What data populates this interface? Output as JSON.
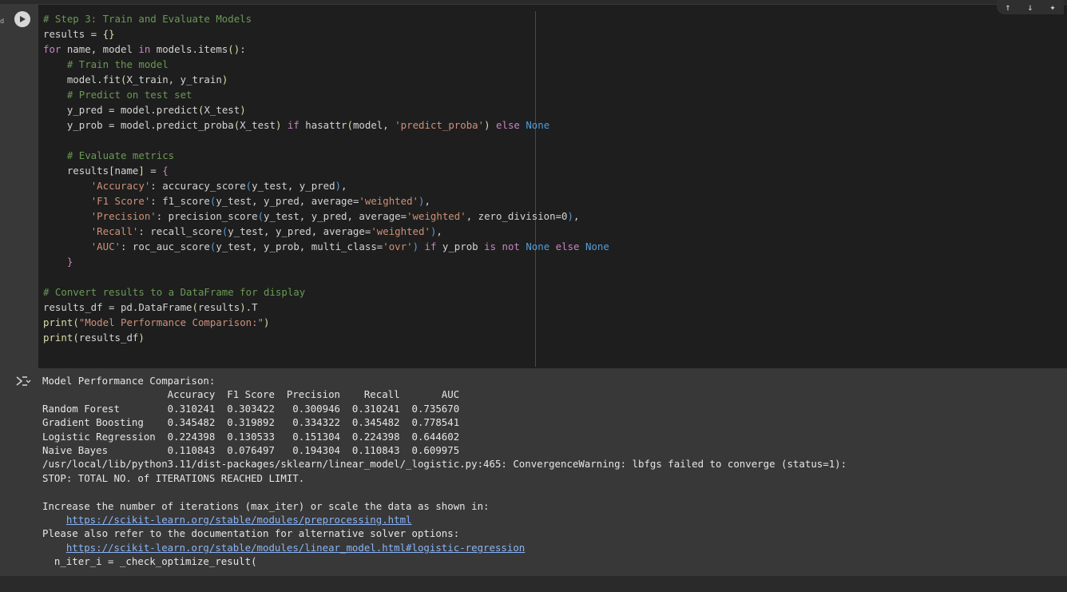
{
  "edge_label": "d",
  "cell": {
    "code_lines": [
      [
        {
          "t": "cm",
          "v": "# Step 3: Train and Evaluate Models"
        }
      ],
      [
        {
          "t": "",
          "v": "results = "
        },
        {
          "t": "fn",
          "v": "{}"
        }
      ],
      [
        {
          "t": "kw",
          "v": "for"
        },
        {
          "t": "",
          "v": " name, model "
        },
        {
          "t": "kw",
          "v": "in"
        },
        {
          "t": "",
          "v": " models.items"
        },
        {
          "t": "fn",
          "v": "()"
        },
        {
          "t": "",
          "v": ":"
        }
      ],
      [
        {
          "t": "",
          "v": "    "
        },
        {
          "t": "cm",
          "v": "# Train the model"
        }
      ],
      [
        {
          "t": "",
          "v": "    model.fit"
        },
        {
          "t": "fn",
          "v": "("
        },
        {
          "t": "",
          "v": "X_train, y_train"
        },
        {
          "t": "fn",
          "v": ")"
        }
      ],
      [
        {
          "t": "",
          "v": "    "
        },
        {
          "t": "cm",
          "v": "# Predict on test set"
        }
      ],
      [
        {
          "t": "",
          "v": "    y_pred = model.predict"
        },
        {
          "t": "fn",
          "v": "("
        },
        {
          "t": "",
          "v": "X_test"
        },
        {
          "t": "fn",
          "v": ")"
        }
      ],
      [
        {
          "t": "",
          "v": "    y_prob = model.predict_proba"
        },
        {
          "t": "fn",
          "v": "("
        },
        {
          "t": "",
          "v": "X_test"
        },
        {
          "t": "fn",
          "v": ")"
        },
        {
          "t": "",
          "v": " "
        },
        {
          "t": "kw",
          "v": "if"
        },
        {
          "t": "",
          "v": " hasattr"
        },
        {
          "t": "fn",
          "v": "("
        },
        {
          "t": "",
          "v": "model, "
        },
        {
          "t": "str",
          "v": "'predict_proba'"
        },
        {
          "t": "fn",
          "v": ")"
        },
        {
          "t": "",
          "v": " "
        },
        {
          "t": "kw",
          "v": "else"
        },
        {
          "t": "",
          "v": " "
        },
        {
          "t": "con",
          "v": "None"
        }
      ],
      [
        {
          "t": "",
          "v": ""
        }
      ],
      [
        {
          "t": "",
          "v": "    "
        },
        {
          "t": "cm",
          "v": "# Evaluate metrics"
        }
      ],
      [
        {
          "t": "",
          "v": "    results"
        },
        {
          "t": "fn",
          "v": "["
        },
        {
          "t": "",
          "v": "name"
        },
        {
          "t": "fn",
          "v": "]"
        },
        {
          "t": "",
          "v": " = "
        },
        {
          "t": "kw",
          "v": "{"
        }
      ],
      [
        {
          "t": "",
          "v": "        "
        },
        {
          "t": "str",
          "v": "'Accuracy'"
        },
        {
          "t": "",
          "v": ": accuracy_score"
        },
        {
          "t": "con",
          "v": "("
        },
        {
          "t": "",
          "v": "y_test, y_pred"
        },
        {
          "t": "con",
          "v": ")"
        },
        {
          "t": "",
          "v": ","
        }
      ],
      [
        {
          "t": "",
          "v": "        "
        },
        {
          "t": "str",
          "v": "'F1 Score'"
        },
        {
          "t": "",
          "v": ": f1_score"
        },
        {
          "t": "con",
          "v": "("
        },
        {
          "t": "",
          "v": "y_test, y_pred, average="
        },
        {
          "t": "str",
          "v": "'weighted'"
        },
        {
          "t": "con",
          "v": ")"
        },
        {
          "t": "",
          "v": ","
        }
      ],
      [
        {
          "t": "",
          "v": "        "
        },
        {
          "t": "str",
          "v": "'Precision'"
        },
        {
          "t": "",
          "v": ": precision_score"
        },
        {
          "t": "con",
          "v": "("
        },
        {
          "t": "",
          "v": "y_test, y_pred, average="
        },
        {
          "t": "str",
          "v": "'weighted'"
        },
        {
          "t": "",
          "v": ", zero_division=0"
        },
        {
          "t": "con",
          "v": ")"
        },
        {
          "t": "",
          "v": ","
        }
      ],
      [
        {
          "t": "",
          "v": "        "
        },
        {
          "t": "str",
          "v": "'Recall'"
        },
        {
          "t": "",
          "v": ": recall_score"
        },
        {
          "t": "con",
          "v": "("
        },
        {
          "t": "",
          "v": "y_test, y_pred, average="
        },
        {
          "t": "str",
          "v": "'weighted'"
        },
        {
          "t": "con",
          "v": ")"
        },
        {
          "t": "",
          "v": ","
        }
      ],
      [
        {
          "t": "",
          "v": "        "
        },
        {
          "t": "str",
          "v": "'AUC'"
        },
        {
          "t": "",
          "v": ": roc_auc_score"
        },
        {
          "t": "con",
          "v": "("
        },
        {
          "t": "",
          "v": "y_test, y_prob, multi_class="
        },
        {
          "t": "str",
          "v": "'ovr'"
        },
        {
          "t": "con",
          "v": ")"
        },
        {
          "t": "",
          "v": " "
        },
        {
          "t": "kw",
          "v": "if"
        },
        {
          "t": "",
          "v": " y_prob "
        },
        {
          "t": "kw",
          "v": "is"
        },
        {
          "t": "",
          "v": " "
        },
        {
          "t": "kw",
          "v": "not"
        },
        {
          "t": "",
          "v": " "
        },
        {
          "t": "con",
          "v": "None"
        },
        {
          "t": "",
          "v": " "
        },
        {
          "t": "kw",
          "v": "else"
        },
        {
          "t": "",
          "v": " "
        },
        {
          "t": "con",
          "v": "None"
        }
      ],
      [
        {
          "t": "",
          "v": "    "
        },
        {
          "t": "kw",
          "v": "}"
        }
      ],
      [
        {
          "t": "",
          "v": ""
        }
      ],
      [
        {
          "t": "cm",
          "v": "# Convert results to a DataFrame for display"
        }
      ],
      [
        {
          "t": "",
          "v": "results_df = pd.DataFrame"
        },
        {
          "t": "fn",
          "v": "("
        },
        {
          "t": "",
          "v": "results"
        },
        {
          "t": "fn",
          "v": ")"
        },
        {
          "t": "",
          "v": ".T"
        }
      ],
      [
        {
          "t": "fn",
          "v": "print"
        },
        {
          "t": "fn",
          "v": "("
        },
        {
          "t": "str",
          "v": "\"Model Performance Comparison:\""
        },
        {
          "t": "fn",
          "v": ")"
        }
      ],
      [
        {
          "t": "fn",
          "v": "print"
        },
        {
          "t": "fn",
          "v": "("
        },
        {
          "t": "",
          "v": "results_df"
        },
        {
          "t": "fn",
          "v": ")"
        }
      ]
    ]
  },
  "output": {
    "heading": "Model Performance Comparison:",
    "table_header": "                     Accuracy  F1 Score  Precision    Recall       AUC",
    "table_rows": [
      "Random Forest        0.310241  0.303422   0.300946  0.310241  0.735670",
      "Gradient Boosting    0.345482  0.319892   0.334322  0.345482  0.778541",
      "Logistic Regression  0.224398  0.130533   0.151304  0.224398  0.644602",
      "Naive Bayes          0.110843  0.076497   0.194304  0.110843  0.609975"
    ],
    "warning_line_1": "/usr/local/lib/python3.11/dist-packages/sklearn/linear_model/_logistic.py:465: ConvergenceWarning: lbfgs failed to converge (status=1):",
    "warning_line_2": "STOP: TOTAL NO. of ITERATIONS REACHED LIMIT.",
    "blank": "",
    "advice_1": "Increase the number of iterations (max_iter) or scale the data as shown in:",
    "link_1": "https://scikit-learn.org/stable/modules/preprocessing.html",
    "advice_2": "Please also refer to the documentation for alternative solver options:",
    "link_2": "https://scikit-learn.org/stable/modules/linear_model.html#logistic-regression",
    "last_line": "  n_iter_i = _check_optimize_result("
  },
  "colors": {
    "comment": "#6a9955",
    "keyword": "#c586c0",
    "string": "#ce9178",
    "constant": "#569cd6",
    "bracket": "#dcdcaa",
    "link": "#8ab4f8"
  }
}
